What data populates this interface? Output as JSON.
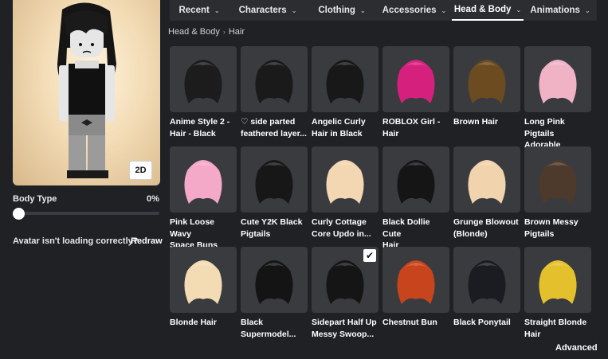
{
  "tabs": [
    {
      "label": "Recent"
    },
    {
      "label": "Characters"
    },
    {
      "label": "Clothing"
    },
    {
      "label": "Accessories"
    },
    {
      "label": "Head & Body"
    },
    {
      "label": "Animations"
    }
  ],
  "breadcrumb": {
    "parent": "Head & Body",
    "current": "Hair"
  },
  "avatar": {
    "view_toggle_label": "2D"
  },
  "body_type": {
    "label": "Body Type",
    "value_text": "0%",
    "value": 0.0
  },
  "loading_issue": {
    "text": "Avatar isn't loading correctly?",
    "action_label": "Redraw"
  },
  "items": [
    {
      "name": "Anime Style 2 - Hair - Black",
      "line1": "Anime Style 2 -",
      "line2": "Hair - Black",
      "color": "#1c1c1c",
      "selected": false
    },
    {
      "name": "♡ side parted feathered layer...",
      "line1": "♡ side parted",
      "line2": "feathered layer...",
      "color": "#1a1a1a",
      "selected": false
    },
    {
      "name": "Angelic Curly Hair in Black",
      "line1": "Angelic Curly",
      "line2": "Hair in Black",
      "color": "#181818",
      "selected": false
    },
    {
      "name": "ROBLOX Girl - Hair",
      "line1": "ROBLOX Girl -",
      "line2": "Hair",
      "color": "#d6207d",
      "selected": false
    },
    {
      "name": "Brown Hair",
      "line1": "Brown Hair",
      "line2": "",
      "color": "#6b4b1f",
      "selected": false
    },
    {
      "name": "Long Pink Pigtails Adorable",
      "line1": "Long Pink",
      "line2": "Pigtails Adorable",
      "color": "#f0b3c6",
      "selected": false
    },
    {
      "name": "Pink Loose Wavy Space Buns",
      "line1": "Pink Loose Wavy",
      "line2": "Space Buns",
      "color": "#f4a9c8",
      "selected": false
    },
    {
      "name": "Cute Y2K Black Pigtails",
      "line1": "Cute Y2K Black",
      "line2": "Pigtails",
      "color": "#171717",
      "selected": false
    },
    {
      "name": "Curly Cottage Core Updo in...",
      "line1": "Curly Cottage",
      "line2": "Core Updo in...",
      "color": "#f3d6b2",
      "selected": false
    },
    {
      "name": "Black Dollie Cute Hair",
      "line1": "Black Dollie Cute",
      "line2": "Hair",
      "color": "#151515",
      "selected": false
    },
    {
      "name": "Grunge Blowout (Blonde)",
      "line1": "Grunge Blowout",
      "line2": "(Blonde)",
      "color": "#f1d3ae",
      "selected": false
    },
    {
      "name": "Brown Messy Pigtails",
      "line1": "Brown Messy",
      "line2": "Pigtails",
      "color": "#4e3a2c",
      "selected": false
    },
    {
      "name": "Blonde Hair",
      "line1": "Blonde Hair",
      "line2": "",
      "color": "#f3dcb3",
      "selected": false
    },
    {
      "name": "Black Supermodel...",
      "line1": "Black",
      "line2": "Supermodel...",
      "color": "#141414",
      "selected": false
    },
    {
      "name": "Sidepart Half Up Messy Swoop...",
      "line1": "Sidepart Half Up",
      "line2": "Messy Swoop...",
      "color": "#151515",
      "selected": true
    },
    {
      "name": "Chestnut Bun",
      "line1": "Chestnut Bun",
      "line2": "",
      "color": "#c8441c",
      "selected": false
    },
    {
      "name": "Black Ponytail",
      "line1": "Black Ponytail",
      "line2": "",
      "color": "#1a1c22",
      "selected": false
    },
    {
      "name": "Straight Blonde Hair",
      "line1": "Straight Blonde",
      "line2": "Hair",
      "color": "#e4c12c",
      "selected": false
    }
  ],
  "footer": {
    "advanced_label": "Advanced"
  },
  "icons": {
    "tab_chevron": "chevron-down-icon",
    "breadcrumb_separator": "chevron-right-icon",
    "selected": "checkmark-icon"
  }
}
